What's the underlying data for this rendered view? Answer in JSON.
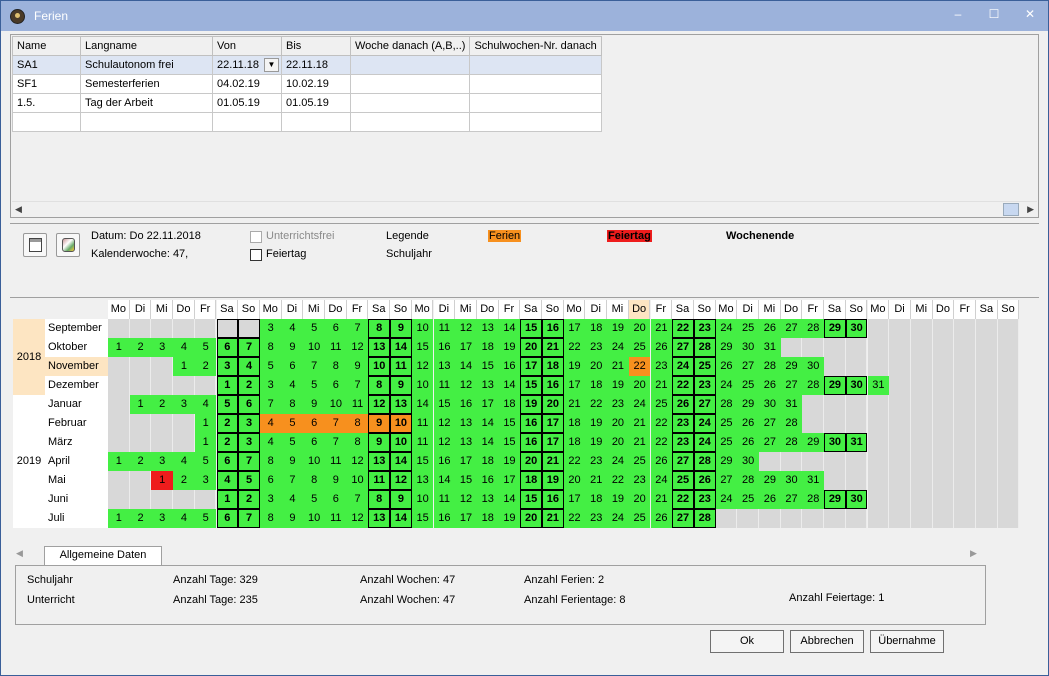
{
  "window": {
    "title": "Ferien",
    "minimize": "–",
    "maximize": "☐",
    "close": "✕"
  },
  "table": {
    "headers": [
      "Name",
      "Langname",
      "Von",
      "Bis",
      "Woche danach (A,B,..)",
      "Schulwochen-Nr. danach"
    ],
    "rows": [
      [
        "SA1",
        "Schulautonom frei",
        "22.11.18",
        "22.11.18",
        "",
        ""
      ],
      [
        "SF1",
        "Semesterferien",
        "04.02.19",
        "10.02.19",
        "",
        ""
      ],
      [
        "1.5.",
        "Tag der Arbeit",
        "01.05.19",
        "01.05.19",
        "",
        ""
      ],
      [
        "",
        "",
        "",
        "",
        "",
        ""
      ]
    ]
  },
  "info": {
    "datum": "Datum: Do 22.11.2018",
    "kalenderwoche": "Kalenderwoche: 47,",
    "unterrichtsfrei": "Unterrichtsfrei",
    "feiertag": "Feiertag",
    "legende": "Legende",
    "schuljahr": "Schuljahr",
    "leg_ferien": "Ferien",
    "leg_feiertag": "Feiertag",
    "leg_wochenende": "Wochenende"
  },
  "calendar": {
    "day_headers": [
      "Mo",
      "Di",
      "Mi",
      "Do",
      "Fr",
      "Sa",
      "So",
      "Mo",
      "Di",
      "Mi",
      "Do",
      "Fr",
      "Sa",
      "So",
      "Mo",
      "Di",
      "Mi",
      "Do",
      "Fr",
      "Sa",
      "So",
      "Mo",
      "Di",
      "Mi",
      "Do",
      "Fr",
      "Sa",
      "So",
      "Mo",
      "Di",
      "Mi",
      "Do",
      "Fr",
      "Sa",
      "So",
      "Mo",
      "Di",
      "Mi",
      "Do",
      "Fr",
      "Sa",
      "So"
    ],
    "years": [
      {
        "label": "2018",
        "rows": 4
      },
      {
        "label": "2019",
        "rows": 7
      }
    ],
    "months": [
      {
        "name": "September",
        "offset": 5,
        "days": 30,
        "green_from": 3
      },
      {
        "name": "Oktober",
        "offset": 0,
        "days": 31
      },
      {
        "name": "November",
        "offset": 3,
        "days": 30
      },
      {
        "name": "Dezember",
        "offset": 5,
        "days": 31
      },
      {
        "name": "Januar",
        "offset": 1,
        "days": 31
      },
      {
        "name": "Februar",
        "offset": 4,
        "days": 28
      },
      {
        "name": "März",
        "offset": 4,
        "days": 31
      },
      {
        "name": "April",
        "offset": 0,
        "days": 30
      },
      {
        "name": "Mai",
        "offset": 2,
        "days": 31
      },
      {
        "name": "Juni",
        "offset": 5,
        "days": 30
      },
      {
        "name": "Juli",
        "offset": 0,
        "days": 28
      }
    ],
    "ferien": [
      {
        "month": 5,
        "day": 4
      },
      {
        "month": 5,
        "day": 5
      },
      {
        "month": 5,
        "day": 6
      },
      {
        "month": 5,
        "day": 7
      },
      {
        "month": 5,
        "day": 8
      },
      {
        "month": 5,
        "day": 9
      },
      {
        "month": 5,
        "day": 10
      },
      {
        "month": 2,
        "day": 22
      }
    ],
    "feiertage": [
      {
        "month": 8,
        "day": 1
      }
    ],
    "selected": {
      "month": 2,
      "day": 22
    }
  },
  "colors": {
    "green": "#44ef44",
    "ferien": "#f7901e",
    "feiertag": "#ee1c1c",
    "empty": "#d8d8d8",
    "year_bg": "#fde5c2"
  },
  "tabs": {
    "active": "Allgemeine Daten"
  },
  "stats": {
    "schuljahr": "Schuljahr",
    "unterricht": "Unterricht",
    "sj_tage": "Anzahl Tage: 329",
    "sj_wochen": "Anzahl Wochen: 47",
    "sj_ferien": "Anzahl Ferien: 2",
    "u_tage": "Anzahl Tage: 235",
    "u_wochen": "Anzahl Wochen: 47",
    "u_ferientage": "Anzahl Ferientage: 8",
    "u_feiertage": "Anzahl Feiertage: 1"
  },
  "buttons": {
    "ok": "Ok",
    "abbrechen": "Abbrechen",
    "uebernahme": "Übernahme"
  }
}
